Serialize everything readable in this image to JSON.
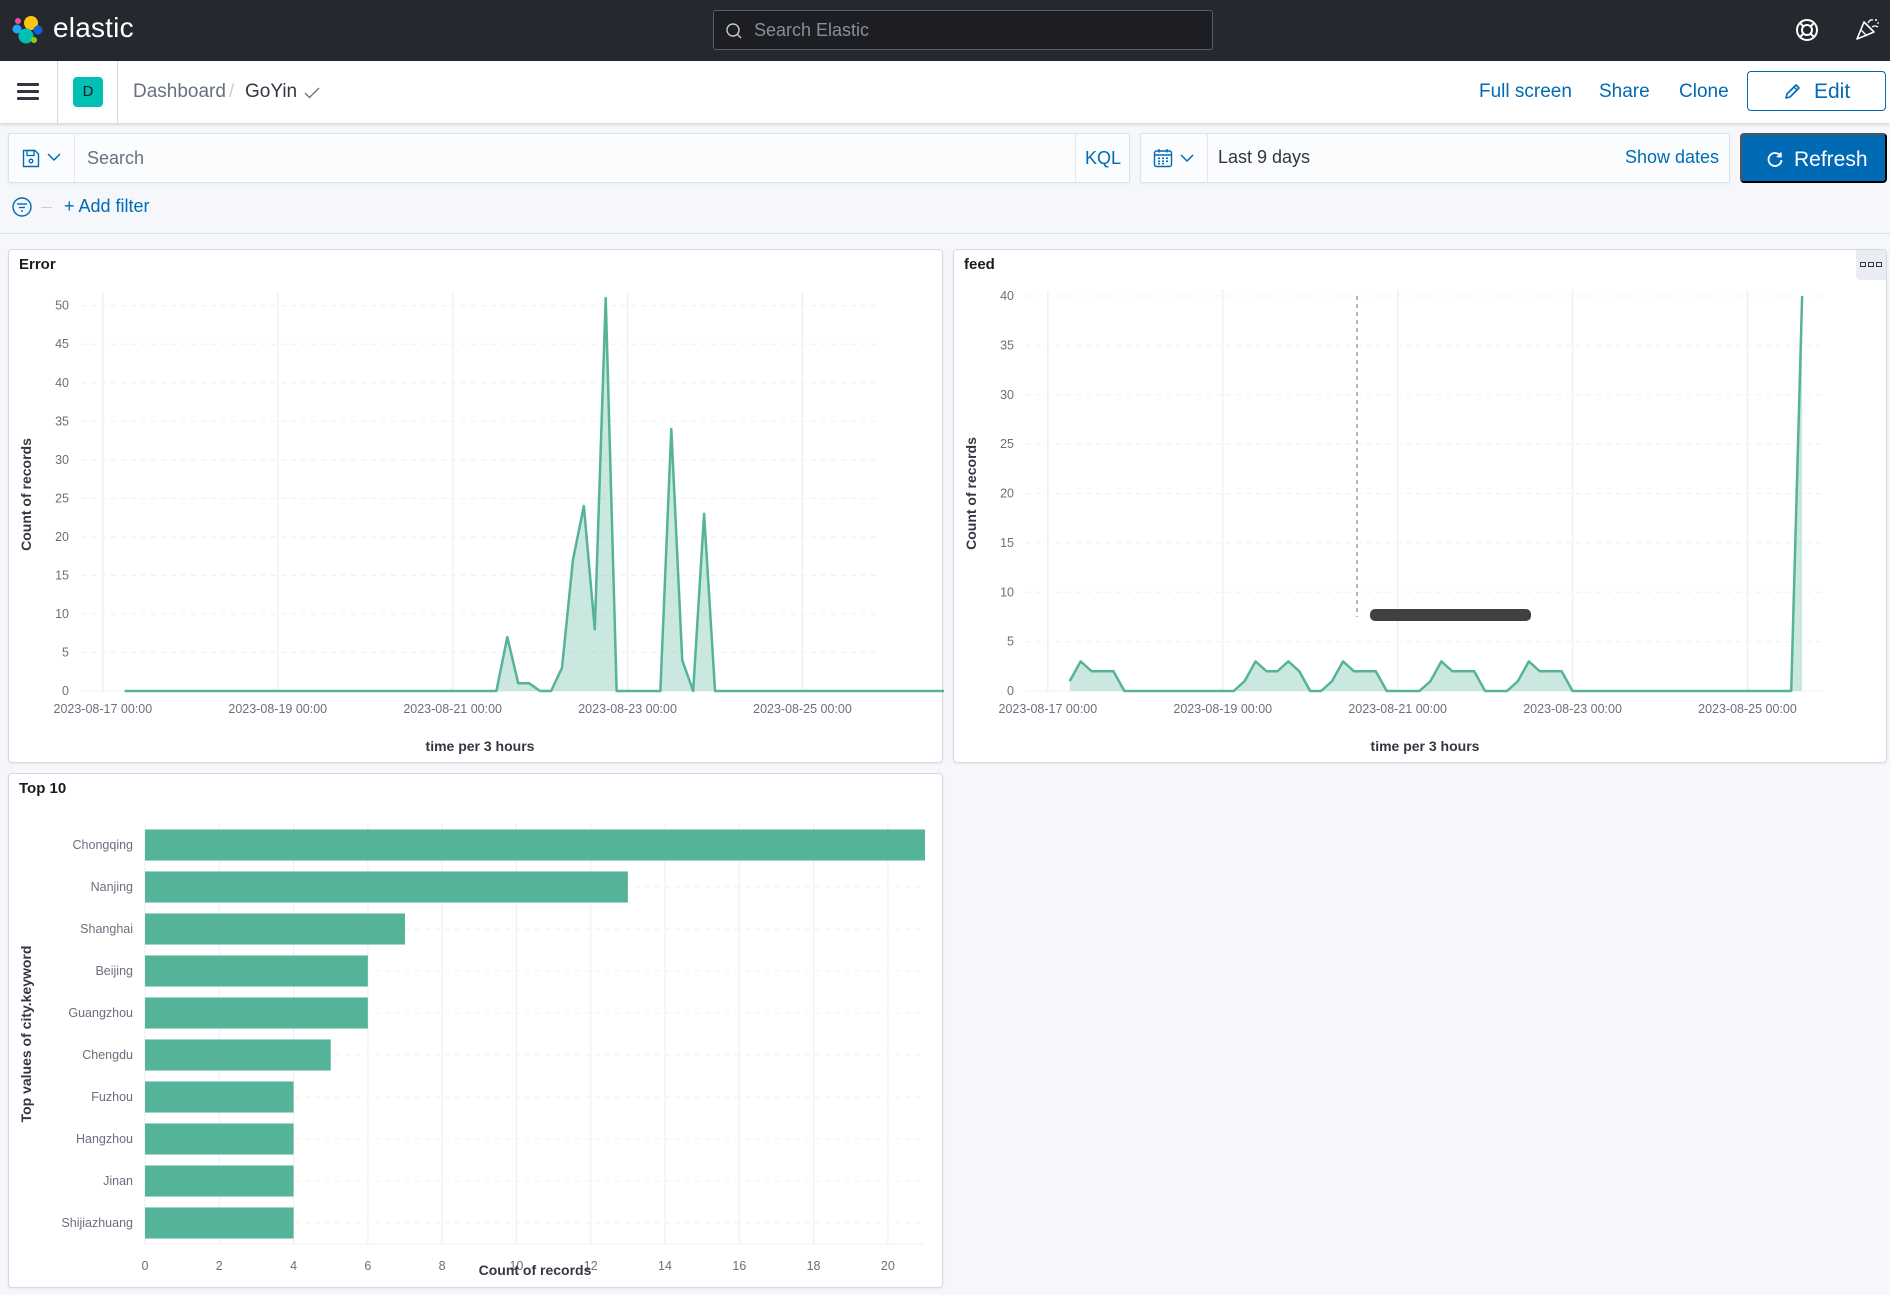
{
  "header": {
    "brand": "elastic",
    "search_placeholder": "Search Elastic",
    "help_icon": "help-lifebuoy-icon",
    "news_icon": "newsfeed-confetti-icon"
  },
  "nav": {
    "app_badge": "D",
    "breadcrumbs": [
      "Dashboard",
      "GoYin"
    ],
    "links": [
      "Full screen",
      "Share",
      "Clone"
    ],
    "edit_label": "Edit"
  },
  "query": {
    "search_placeholder": "Search",
    "language": "KQL",
    "time_range": "Last 9 days",
    "show_dates": "Show dates",
    "refresh_label": "Refresh",
    "add_filter": "+ Add filter"
  },
  "colors": {
    "accent": "#006bb4",
    "series": "#54b399",
    "header_bg": "#25282f"
  },
  "panels": {
    "error": {
      "title": "Error"
    },
    "feed": {
      "title": "feed"
    },
    "top10": {
      "title": "Top 10"
    }
  },
  "chart_data": [
    {
      "id": "error",
      "type": "area",
      "title": "Error",
      "xlabel": "time per 3 hours",
      "ylabel": "Count of records",
      "interval_hours": 3,
      "xlim": [
        "2023-08-16 18:00",
        "2023-08-25 21:00"
      ],
      "ylim": [
        0,
        51
      ],
      "yticks": [
        0,
        5,
        10,
        15,
        20,
        25,
        30,
        35,
        40,
        45,
        50
      ],
      "xticks": [
        "2023-08-17 00:00",
        "2023-08-19 00:00",
        "2023-08-21 00:00",
        "2023-08-23 00:00",
        "2023-08-25 00:00"
      ],
      "grid": true,
      "series": [
        {
          "name": "Count of records",
          "start": "2023-08-17 06:00",
          "values": [
            0,
            0,
            0,
            0,
            0,
            0,
            0,
            0,
            0,
            0,
            0,
            0,
            0,
            0,
            0,
            0,
            0,
            0,
            0,
            0,
            0,
            0,
            0,
            0,
            0,
            0,
            0,
            0,
            0,
            0,
            0,
            0,
            0,
            0,
            0,
            7,
            1,
            1,
            0,
            0,
            3,
            17,
            24,
            8,
            51,
            0,
            0,
            0,
            0,
            0,
            34,
            4,
            0,
            23,
            0,
            0,
            0,
            0,
            0,
            0,
            0,
            0,
            0,
            0,
            0,
            0,
            0,
            0,
            0,
            0,
            0,
            0,
            0,
            0,
            0,
            0,
            0,
            0,
            0
          ]
        }
      ]
    },
    {
      "id": "feed",
      "type": "area",
      "title": "feed",
      "xlabel": "time per 3 hours",
      "ylabel": "Count of records",
      "interval_hours": 3,
      "xlim": [
        "2023-08-16 18:00",
        "2023-08-25 21:00"
      ],
      "ylim": [
        0,
        40
      ],
      "yticks": [
        0,
        5,
        10,
        15,
        20,
        25,
        30,
        35,
        40
      ],
      "xticks": [
        "2023-08-17 00:00",
        "2023-08-19 00:00",
        "2023-08-21 00:00",
        "2023-08-23 00:00",
        "2023-08-25 00:00"
      ],
      "grid": true,
      "series": [
        {
          "name": "Count of records",
          "start": "2023-08-17 06:00",
          "values": [
            1,
            3,
            2,
            2,
            2,
            0,
            0,
            0,
            0,
            0,
            0,
            0,
            0,
            0,
            0,
            0,
            1,
            3,
            2,
            2,
            3,
            2,
            0,
            0,
            1,
            3,
            2,
            2,
            2,
            0,
            0,
            0,
            0,
            1,
            3,
            2,
            2,
            2,
            0,
            0,
            0,
            1,
            3,
            2,
            2,
            2,
            0,
            0,
            0,
            0,
            0,
            0,
            0,
            0,
            0,
            0,
            0,
            0,
            0,
            0,
            0,
            0,
            0,
            0,
            0,
            0,
            0,
            40
          ]
        }
      ]
    },
    {
      "id": "top10",
      "type": "bar",
      "orientation": "horizontal",
      "title": "Top 10",
      "xlabel": "Count of records",
      "ylabel": "Top values of city.keyword",
      "categories": [
        "Chongqing",
        "Nanjing",
        "Shanghai",
        "Beijing",
        "Guangzhou",
        "Chengdu",
        "Fuzhou",
        "Hangzhou",
        "Jinan",
        "Shijiazhuang"
      ],
      "values": [
        21,
        13,
        7,
        6,
        6,
        5,
        4,
        4,
        4,
        4
      ],
      "xlim": [
        0,
        21
      ],
      "xticks": [
        0,
        2,
        4,
        6,
        8,
        10,
        12,
        14,
        16,
        18,
        20
      ],
      "grid": true
    }
  ]
}
